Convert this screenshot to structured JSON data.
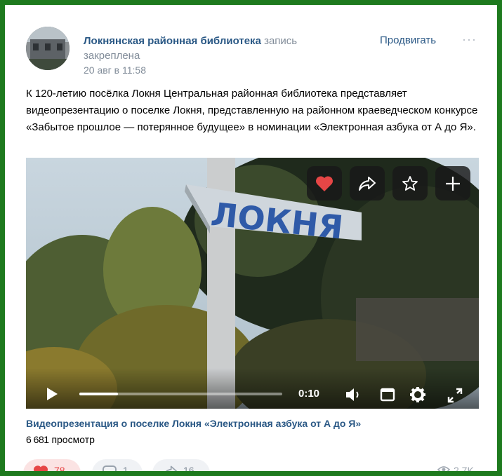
{
  "post": {
    "author_name": "Локнянская районная библиотека",
    "author_suffix": "запись закреплена",
    "date": "20 авг в 11:58",
    "promote_label": "Продвигать",
    "more_label": "···",
    "text": "К 120-летию посёлка Локня Центральная районная библиотека представляет видеопрезентацию о поселке Локня, представленную на районном краеведческом конкурсе «Забытое прошлое — потерянное будущее» в номинации «Электронная азбука от А до Я»."
  },
  "video": {
    "sign_text": "ЛОКНЯ",
    "timecode": "0:10",
    "progress": 0.19,
    "caption": "Видеопрезентация о поселке Локня «Электронная азбука от А до Я»",
    "views_count": "6 681",
    "views_label": "просмотр",
    "overlay_buttons": [
      "heart-icon",
      "share-icon",
      "star-icon",
      "plus-icon"
    ]
  },
  "actions": {
    "likes": "78",
    "comments": "1",
    "shares": "16",
    "views": "2,7K"
  },
  "colors": {
    "frame": "#1e7a1e",
    "link": "#2a5885",
    "muted": "#818c99",
    "like_red": "#e64646",
    "sign_blue": "#2f5aa8"
  }
}
